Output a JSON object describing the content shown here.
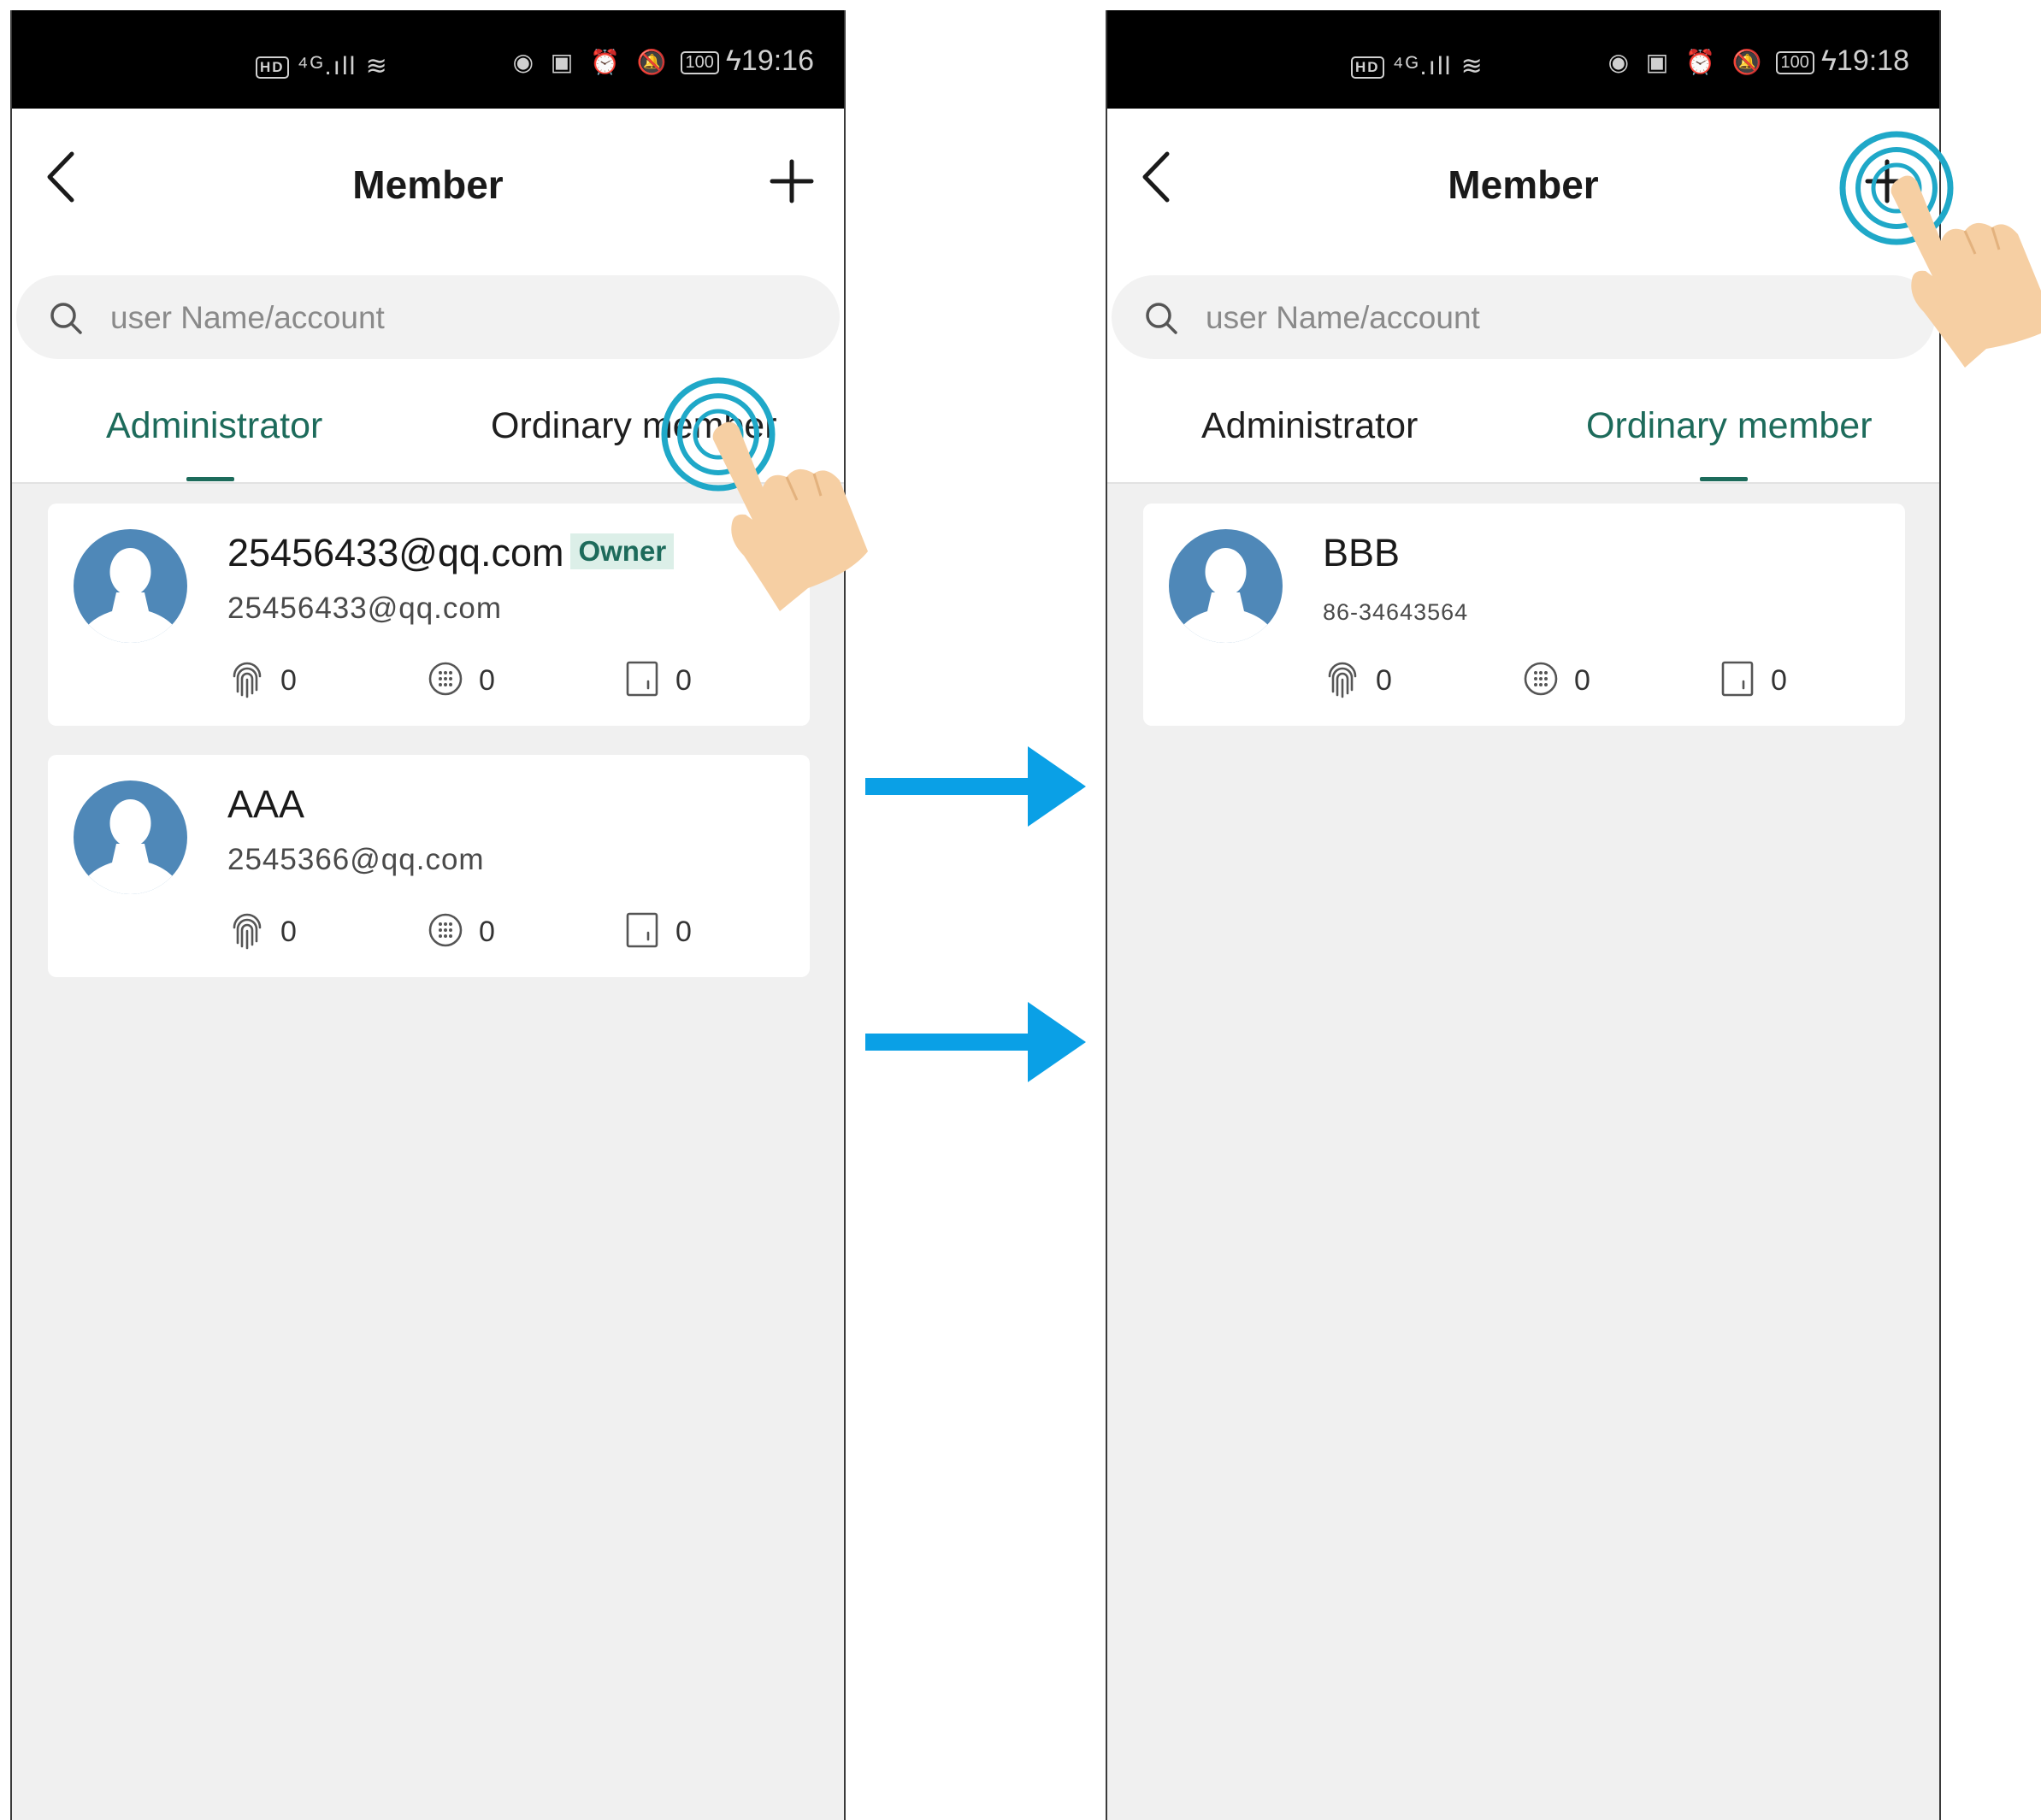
{
  "screens": [
    {
      "status": {
        "network": "⁴ᴳ.ıll",
        "hd": "HD",
        "battery": "100",
        "time": "19:16"
      },
      "header": {
        "title": "Member"
      },
      "search": {
        "placeholder": "user Name/account"
      },
      "tabs": [
        {
          "label": "Administrator"
        },
        {
          "label": "Ordinary member"
        }
      ],
      "active_tab": "Administrator",
      "members": [
        {
          "name": "25456433@qq.com",
          "badge": "Owner",
          "account": "25456433@qq.com",
          "fingerprints": "0",
          "passwords": "0",
          "cards": "0"
        },
        {
          "name": "AAA",
          "account": "2545366@qq.com",
          "fingerprints": "0",
          "passwords": "0",
          "cards": "0"
        }
      ]
    },
    {
      "status": {
        "network": "⁴ᴳ.ıll",
        "hd": "HD",
        "battery": "100",
        "time": "19:18"
      },
      "header": {
        "title": "Member"
      },
      "search": {
        "placeholder": "user Name/account"
      },
      "tabs": [
        {
          "label": "Administrator"
        },
        {
          "label": "Ordinary member"
        }
      ],
      "active_tab": "Ordinary member",
      "members": [
        {
          "name": "BBB",
          "account": "86-34643564",
          "fingerprints": "0",
          "passwords": "0",
          "cards": "0"
        }
      ]
    }
  ],
  "colors": {
    "accent": "#1d6b5b",
    "arrow": "#0aa0e6",
    "tap_ring": "#1fa8c8",
    "avatar": "#4f88b8",
    "hand": "#f6cfa3"
  },
  "icons": [
    "back-arrow-icon",
    "plus-icon",
    "search-icon",
    "fingerprint-icon",
    "keypad-icon",
    "card-icon",
    "pointing-hand-icon",
    "right-arrow-icon"
  ]
}
